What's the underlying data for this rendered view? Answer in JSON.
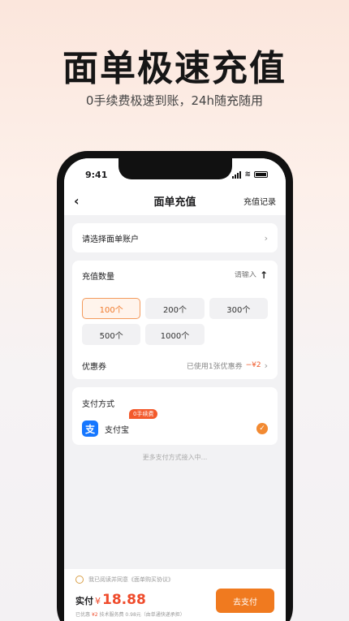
{
  "hero": {
    "title": "面单极速充值",
    "subtitle": "0手续费极速到账，24h随充随用"
  },
  "status_bar": {
    "time": "9:41"
  },
  "nav": {
    "back_icon": "‹",
    "title": "面单充值",
    "record": "充值记录"
  },
  "account": {
    "label": "请选择面单账户",
    "chevron": "›"
  },
  "quantity": {
    "label": "充值数量",
    "placeholder": "请输入",
    "toggle_icon": "↑",
    "options": [
      "100个",
      "200个",
      "300个",
      "500个",
      "1000个"
    ],
    "selected_index": 0
  },
  "coupon": {
    "label": "优惠券",
    "used_text": "已使用1张优惠券",
    "amount": "−¥2",
    "chevron": "›"
  },
  "payment": {
    "title": "支付方式",
    "method_icon": "支",
    "method_name": "支付宝",
    "badge": "0手续费",
    "check_icon": "✓",
    "more_text": "更多支付方式接入中..."
  },
  "checkout": {
    "agree_text": "我已阅读并同意《面单购买协议》",
    "pay_label": "实付",
    "currency": "¥",
    "amount": "18.88",
    "savings_prefix": "已优惠",
    "savings_amount": "¥2",
    "savings_note": "技术服务费 0.98元（由单通快递承担）",
    "go_pay": "去支付"
  },
  "colors": {
    "accent": "#f07a1f",
    "price": "#ef4b2b",
    "alipay": "#1677ff"
  }
}
